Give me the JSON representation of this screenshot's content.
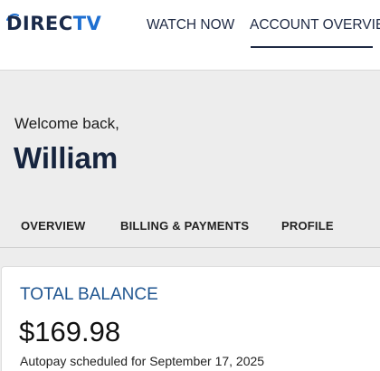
{
  "header": {
    "logo": {
      "text_main": "DIREC",
      "text_accent": "TV",
      "icon": "directv-swoosh-logo"
    },
    "nav": {
      "watch_now": "WATCH NOW",
      "account_overview": "ACCOUNT OVERVIEW",
      "active": "account_overview"
    }
  },
  "welcome": {
    "greeting": "Welcome back,",
    "name": "William"
  },
  "tabs": [
    {
      "label": "OVERVIEW"
    },
    {
      "label": "BILLING & PAYMENTS"
    },
    {
      "label": "PROFILE"
    }
  ],
  "balance_card": {
    "title": "TOTAL BALANCE",
    "amount": "$169.98",
    "autopay_note": "Autopay scheduled for September 17, 2025"
  },
  "colors": {
    "brand_navy": "#16243e",
    "brand_blue": "#1e6fd1",
    "accent_title": "#1f5590",
    "page_background": "#ededed"
  }
}
